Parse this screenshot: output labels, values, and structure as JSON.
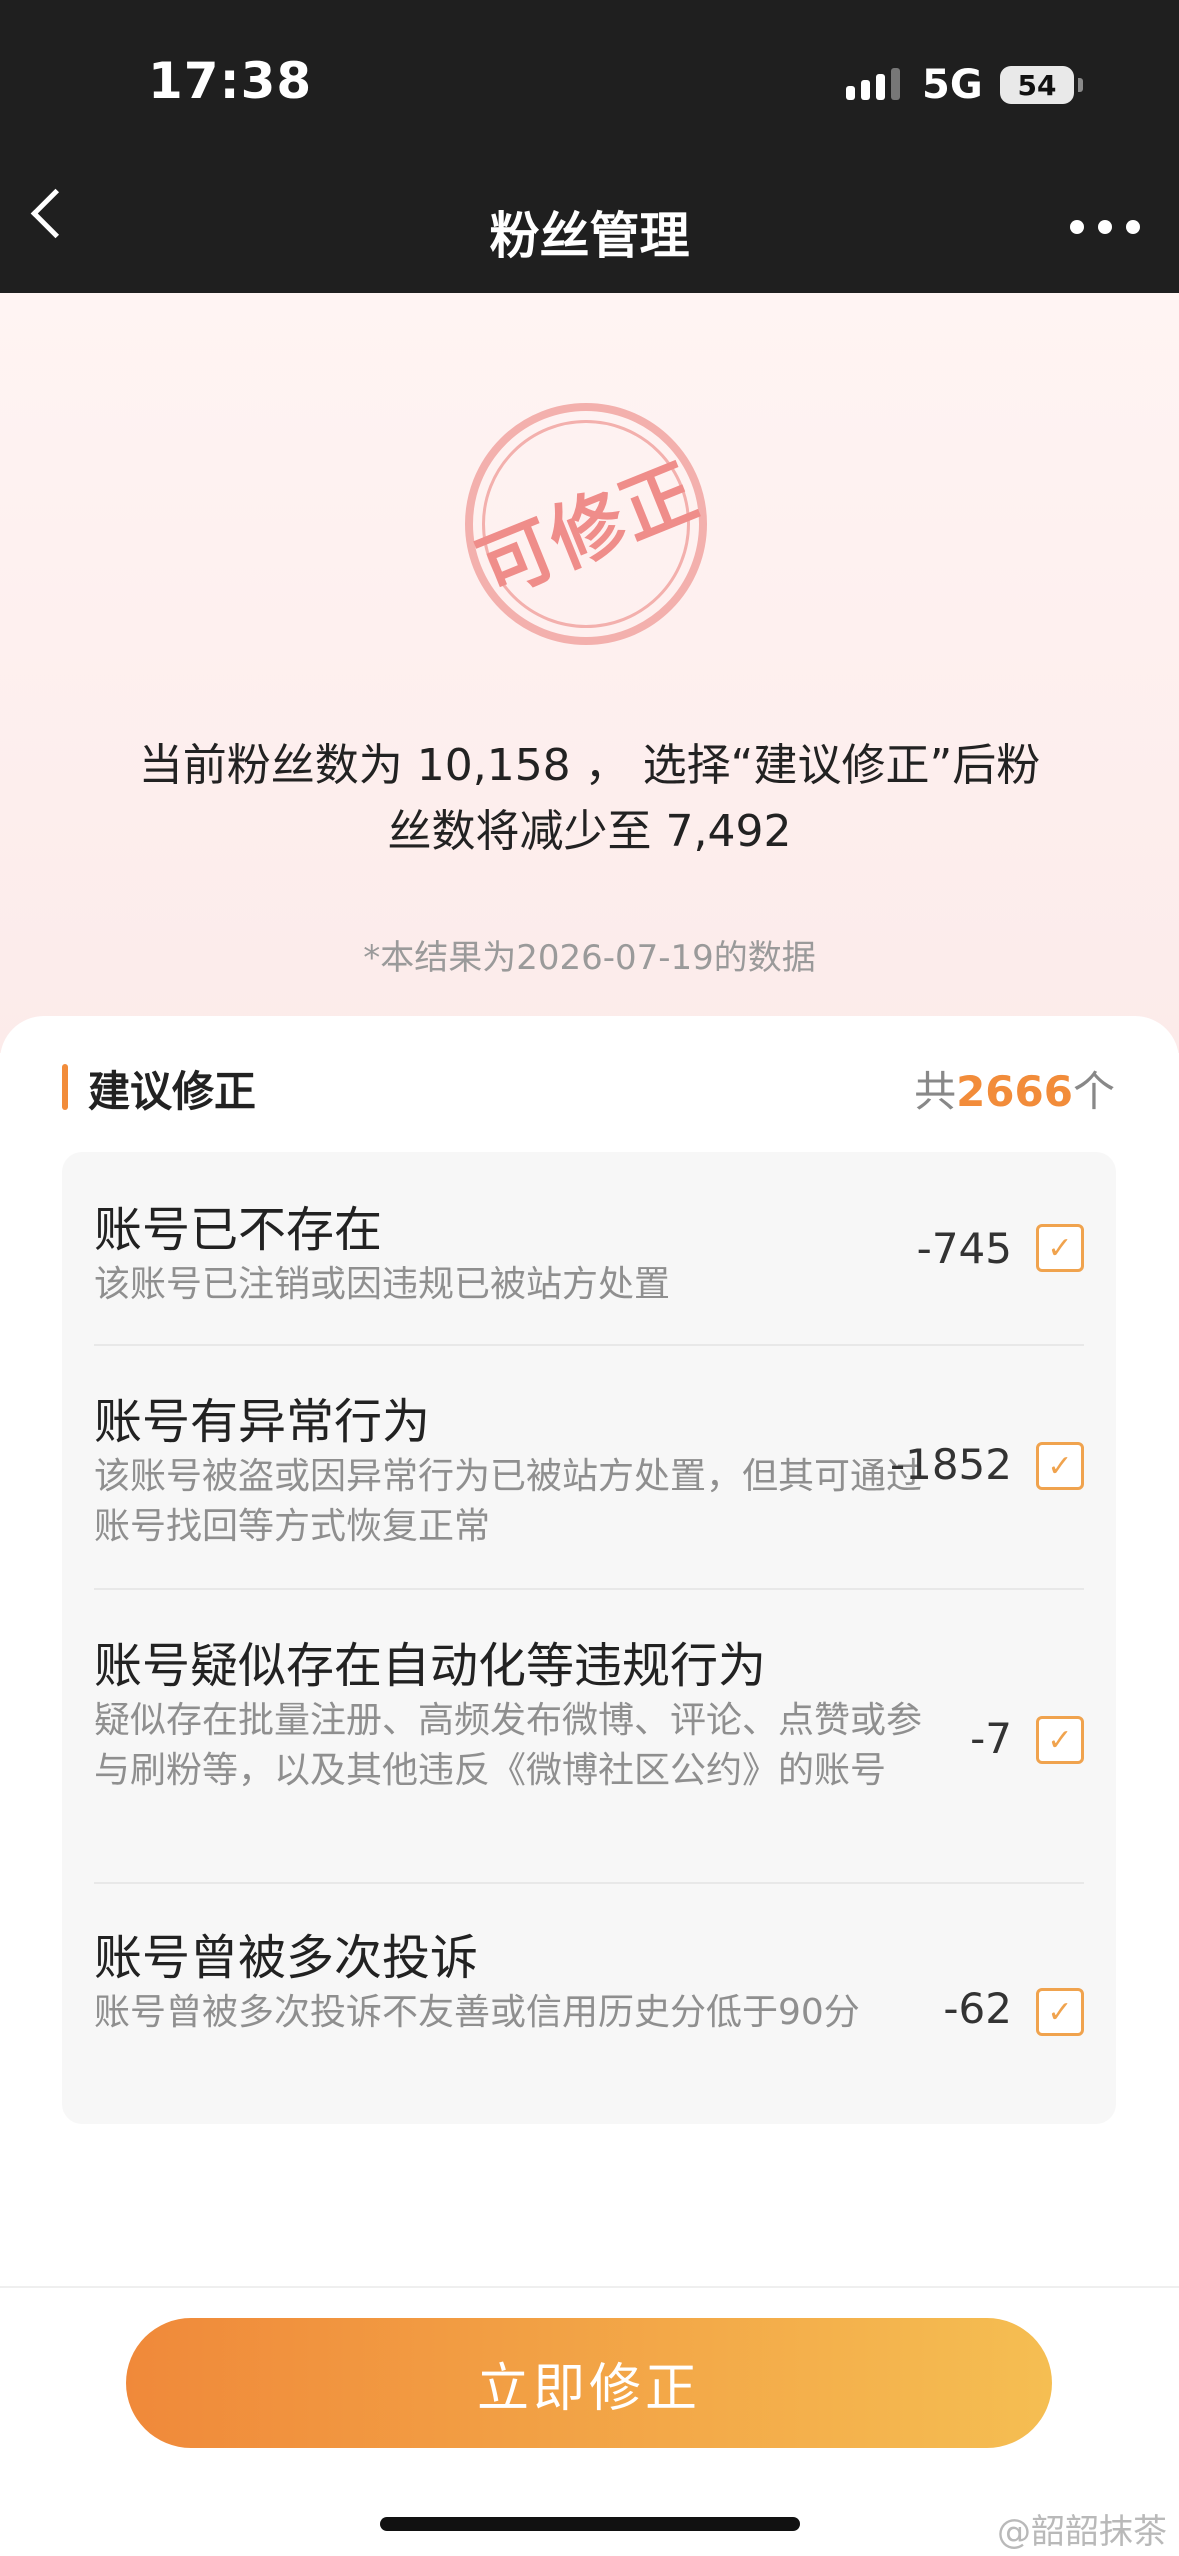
{
  "status_bar": {
    "time": "17:38",
    "network": "5G",
    "battery": "54"
  },
  "nav": {
    "title": "粉丝管理"
  },
  "hero": {
    "stamp": "可修正",
    "summary_line1": "当前粉丝数为 10,158 ， 选择“建议修正”后粉",
    "summary_line2": "丝数将减少至 7,492",
    "footnote": "*本结果为2026-07-19的数据"
  },
  "section": {
    "title": "建议修正",
    "count_prefix": "共",
    "count": "2666",
    "count_suffix": "个"
  },
  "items": [
    {
      "title": "账号已不存在",
      "desc": "该账号已注销或因违规已被站方处置",
      "value": "-745",
      "checked": true
    },
    {
      "title": "账号有异常行为",
      "desc": "该账号被盗或因异常行为已被站方处置，但其可通过账号找回等方式恢复正常",
      "value": "-1852",
      "checked": true
    },
    {
      "title": "账号疑似存在自动化等违规行为",
      "desc": "疑似存在批量注册、高频发布微博、评论、点赞或参与刷粉等，以及其他违反《微博社区公约》的账号",
      "value": "-7",
      "checked": true
    },
    {
      "title": "账号曾被多次投诉",
      "desc": "账号曾被多次投诉不友善或信用历史分低于90分",
      "value": "-62",
      "checked": true
    }
  ],
  "cta": {
    "label": "立即修正"
  },
  "watermark": "@韶韶抹茶",
  "colors": {
    "accent": "#f28c3a",
    "stamp": "#ef8d8a",
    "nav_bg": "#1f1f1f"
  }
}
